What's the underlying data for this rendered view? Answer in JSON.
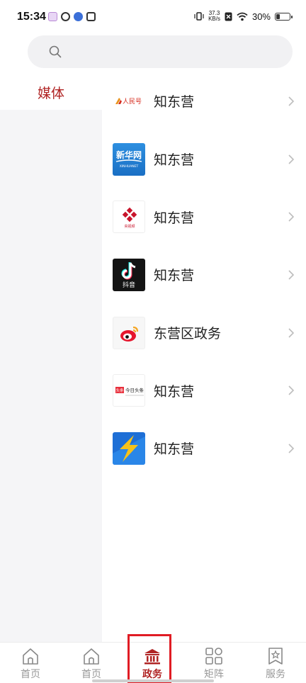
{
  "status_bar": {
    "time": "15:34",
    "net_speed_value": "37.3",
    "net_speed_unit": "KB/s",
    "battery_percent": "30%",
    "battery_level": 0.3
  },
  "search": {
    "placeholder": ""
  },
  "sidebar": {
    "items": [
      {
        "label": "媒体",
        "active": true
      }
    ]
  },
  "list": {
    "items": [
      {
        "name": "知东营",
        "logo_text": "人民号",
        "icon": "people-daily-logo"
      },
      {
        "name": "知东营",
        "logo_text": "新华网",
        "logo_subtext": "XINHUANET",
        "icon": "xinhua-logo"
      },
      {
        "name": "知东营",
        "logo_text": "央视频",
        "icon": "cctv-video-logo"
      },
      {
        "name": "知东营",
        "logo_text": "抖音",
        "icon": "douyin-logo"
      },
      {
        "name": "东营区政务",
        "icon": "weibo-logo"
      },
      {
        "name": "知东营",
        "logo_text": "今日头条",
        "logo_badge": "头条",
        "icon": "toutiao-logo"
      },
      {
        "name": "知东营",
        "icon": "lightning-app-logo"
      }
    ]
  },
  "bottom_nav": {
    "items": [
      {
        "label": "首页",
        "icon": "home-icon"
      },
      {
        "label": "首页",
        "icon": "home-icon"
      },
      {
        "label": "政务",
        "icon": "government-icon",
        "active": true
      },
      {
        "label": "矩阵",
        "icon": "grid-icon"
      },
      {
        "label": "服务",
        "icon": "bookmark-star-icon"
      }
    ]
  },
  "colors": {
    "accent": "#b02424",
    "highlight_border": "#e01c24",
    "sidebar_bg": "#f5f5f7",
    "search_bg": "#f1f1f3"
  }
}
